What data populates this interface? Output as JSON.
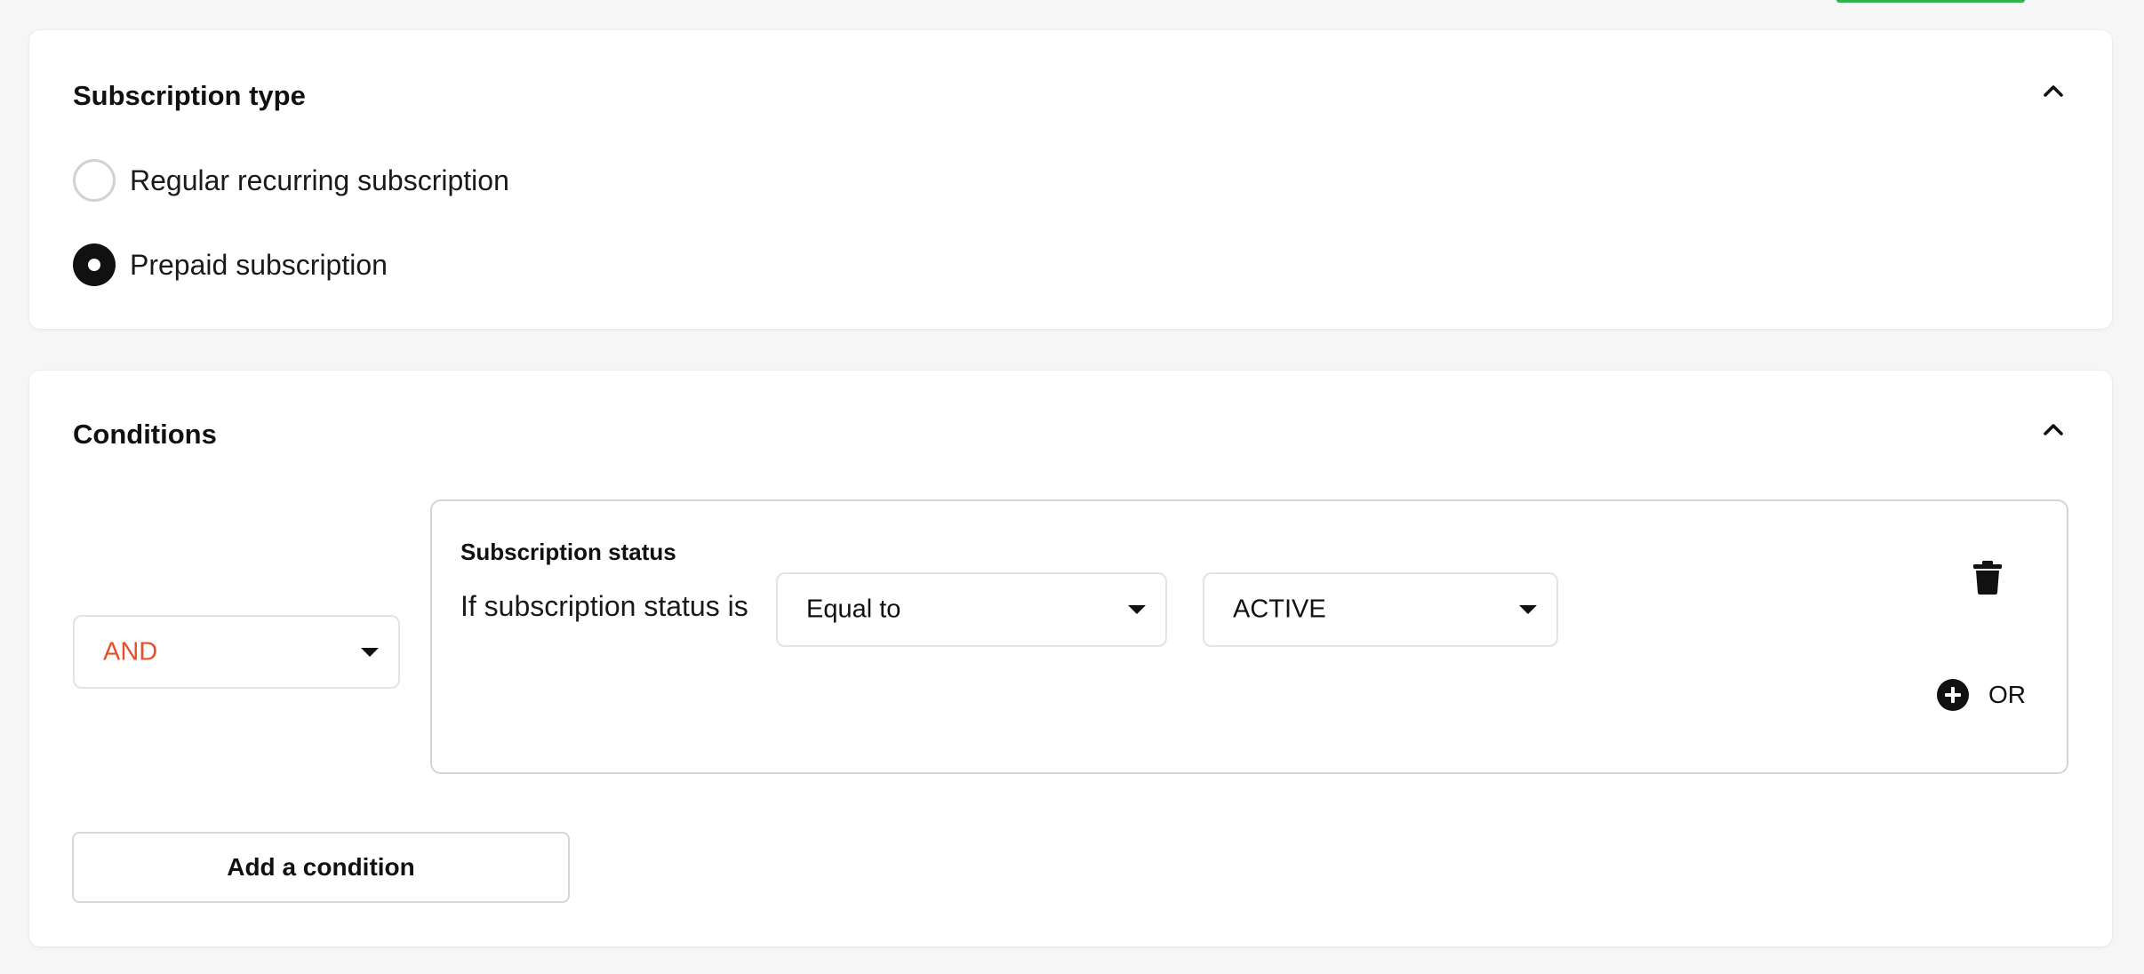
{
  "subscription_type": {
    "title": "Subscription type",
    "options": [
      {
        "label": "Regular recurring subscription",
        "selected": false
      },
      {
        "label": "Prepaid subscription",
        "selected": true
      }
    ]
  },
  "conditions": {
    "title": "Conditions",
    "logic_operator": {
      "value": "AND",
      "color": "#e8502b"
    },
    "group": {
      "label": "Subscription status",
      "prefix_text": "If subscription status is",
      "comparator": {
        "value": "Equal to"
      },
      "status": {
        "value": "ACTIVE"
      },
      "or_label": "OR",
      "delete_icon": "trash-icon",
      "add_or_icon": "plus-circle-icon"
    },
    "add_button_label": "Add a condition"
  },
  "colors": {
    "accent_green": "#2fb34a",
    "operator_orange": "#e8502b",
    "text_primary": "#111111",
    "border": "#d4d4d6"
  }
}
